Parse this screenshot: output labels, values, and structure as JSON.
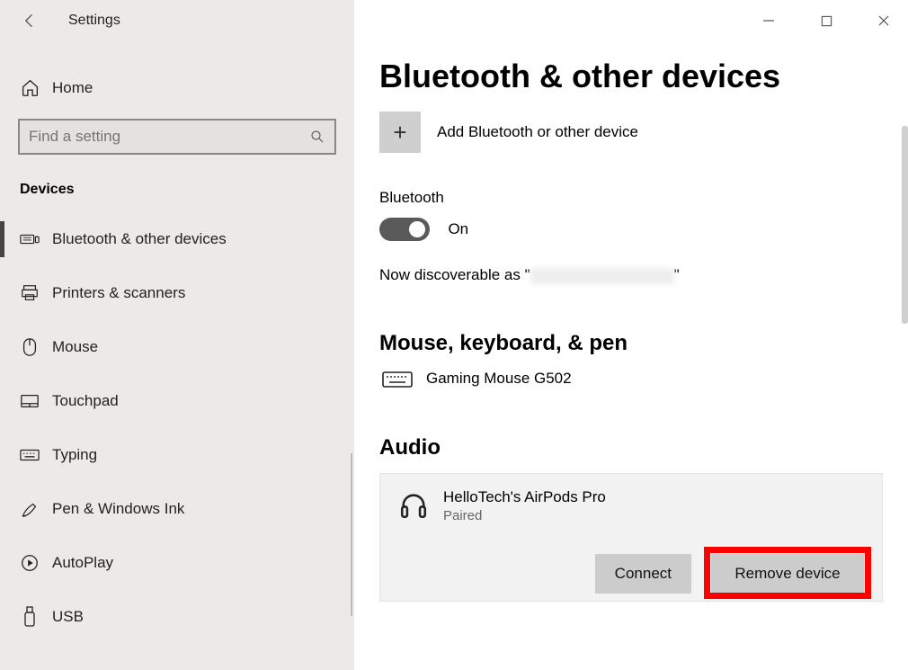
{
  "window": {
    "title": "Settings"
  },
  "sidebar": {
    "home_label": "Home",
    "search_placeholder": "Find a setting",
    "category": "Devices",
    "items": [
      {
        "label": "Bluetooth & other devices",
        "active": true
      },
      {
        "label": "Printers & scanners",
        "active": false
      },
      {
        "label": "Mouse",
        "active": false
      },
      {
        "label": "Touchpad",
        "active": false
      },
      {
        "label": "Typing",
        "active": false
      },
      {
        "label": "Pen & Windows Ink",
        "active": false
      },
      {
        "label": "AutoPlay",
        "active": false
      },
      {
        "label": "USB",
        "active": false
      }
    ]
  },
  "main": {
    "page_title": "Bluetooth & other devices",
    "add_label": "Add Bluetooth or other device",
    "bluetooth_label": "Bluetooth",
    "bluetooth_state": "On",
    "discoverable_prefix": "Now discoverable as \"",
    "discoverable_suffix": "\"",
    "mouse_section": "Mouse, keyboard, & pen",
    "mouse_device": "Gaming Mouse G502",
    "audio_section": "Audio",
    "audio_device": {
      "name": "HelloTech's AirPods Pro",
      "status": "Paired"
    },
    "buttons": {
      "connect": "Connect",
      "remove": "Remove device"
    }
  }
}
